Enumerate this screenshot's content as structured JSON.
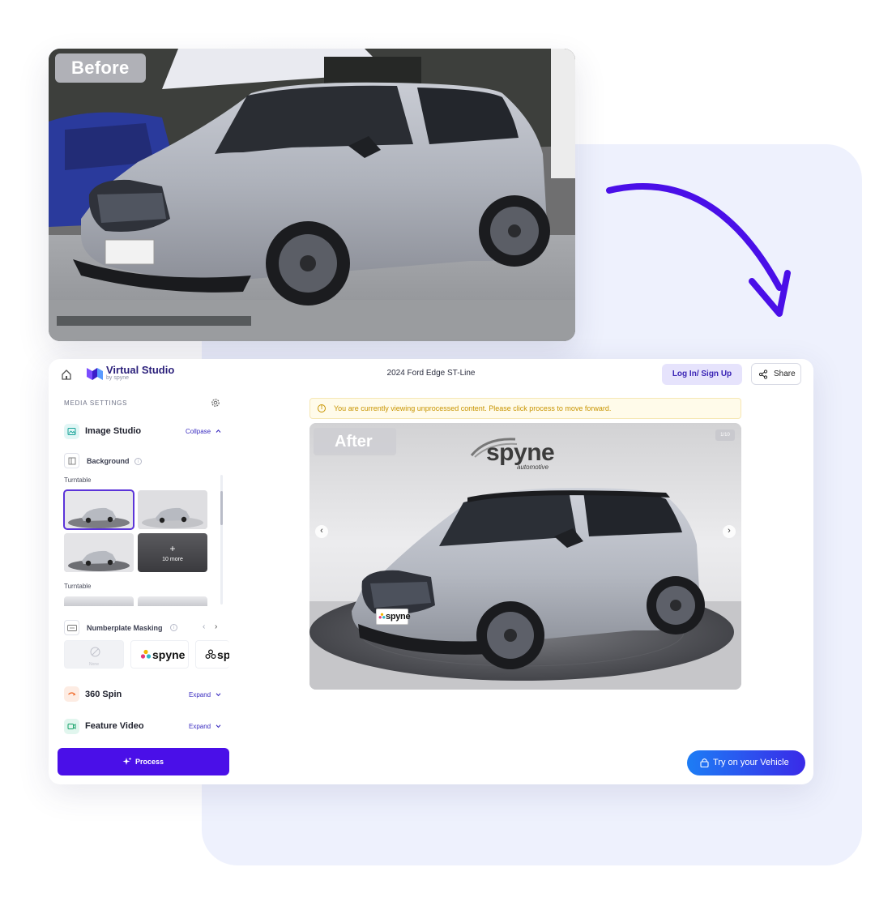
{
  "before_label": "Before",
  "after_label": "After",
  "header": {
    "brand_name": "Virtual Studio",
    "brand_sub": "by spyne",
    "title": "2024 Ford Edge ST-Line",
    "login_label": "Log In/ Sign Up",
    "share_label": "Share"
  },
  "sidebar": {
    "media_settings_label": "MEDIA SETTINGS",
    "image_studio": {
      "label": "Image Studio",
      "action": "Collpase"
    },
    "background": {
      "label": "Background",
      "group1_label": "Turntable",
      "group2_label": "Turntable",
      "more_label": "10 more"
    },
    "numberplate": {
      "label": "Numberplate Masking",
      "none_label": "None",
      "option1": "spyne",
      "option2": "spy"
    },
    "spin": {
      "label": "360 Spin",
      "action": "Expand"
    },
    "video": {
      "label": "Feature Video",
      "action": "Expand"
    },
    "process_label": "Process"
  },
  "viewer": {
    "warning": "You are currently viewing unprocessed content. Please click process to move forward.",
    "counter": "1/10",
    "watermark": "spyne",
    "watermark_sub": "automotive",
    "plate_text": "spyne"
  },
  "cta": {
    "try_label": "Try on your Vehicle"
  },
  "colors": {
    "accent": "#4a0fe8",
    "brand": "#2a1f7a",
    "panel_bg": "#eef1fd",
    "warning": "#c89400",
    "arrow": "#4a0fe8"
  },
  "icons": [
    "home-icon",
    "brand-logo-icon",
    "share-icon",
    "gear-icon",
    "image-icon",
    "info-icon",
    "chevron-up-icon",
    "chevron-down-icon",
    "chevron-left-icon",
    "chevron-right-icon",
    "block-icon",
    "spin-icon",
    "video-icon",
    "sparkle-icon",
    "lock-icon",
    "warning-icon"
  ]
}
